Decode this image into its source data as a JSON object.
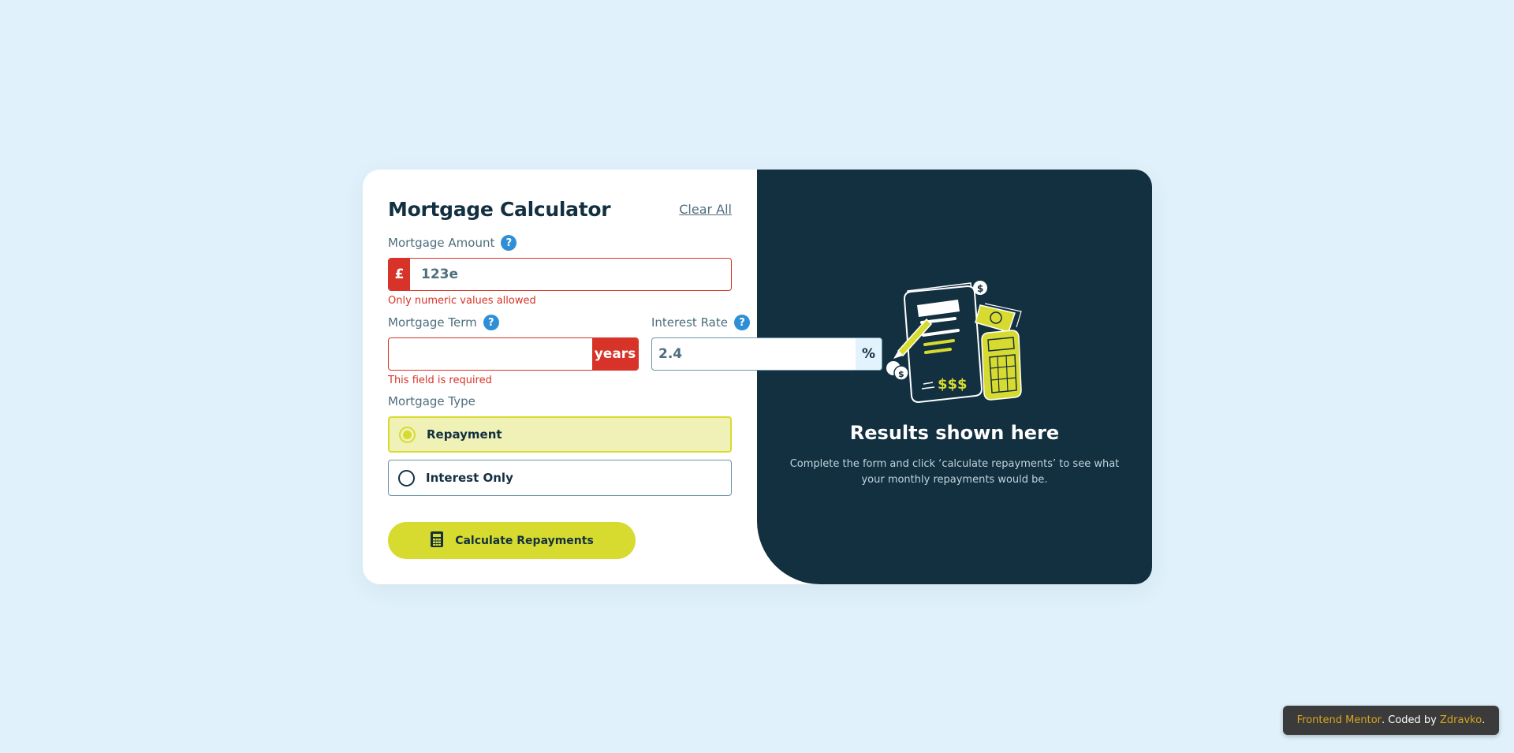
{
  "header": {
    "title": "Mortgage Calculator",
    "clear_label": "Clear All"
  },
  "amount": {
    "label": "Mortgage Amount",
    "help": "?",
    "prefix": "£",
    "value": "123e",
    "error": "Only numeric values allowed"
  },
  "term": {
    "label": "Mortgage Term",
    "help": "?",
    "suffix": "years",
    "value": "",
    "error": "This field is required"
  },
  "rate": {
    "label": "Interest Rate",
    "help": "?",
    "suffix": "%",
    "value": "2.4"
  },
  "type": {
    "label": "Mortgage Type",
    "options": [
      {
        "label": "Repayment",
        "selected": true
      },
      {
        "label": "Interest Only",
        "selected": false
      }
    ]
  },
  "calc_button": {
    "label": "Calculate Repayments",
    "icon": "calculator-icon"
  },
  "results": {
    "title": "Results shown here",
    "description": "Complete the form and click ‘calculate repayments’ to see what your monthly repayments would be."
  },
  "attribution": {
    "link1": "Frontend Mentor",
    "middle": ". Coded by ",
    "link2": "Zdravko",
    "end": "."
  },
  "colors": {
    "background": "#e0f1fb",
    "dark": "#133040",
    "lime": "#d8db2f",
    "error": "#d73328",
    "help_blue": "#2f8fd6"
  }
}
